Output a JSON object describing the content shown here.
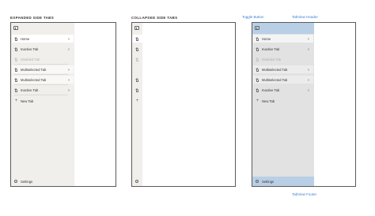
{
  "sections": {
    "expanded_title": "EXPANDED SIDE TABS",
    "collapsed_title": "COLLAPSED SIDE TABS"
  },
  "annotations": {
    "toggle_button": "Toggle Button",
    "tabview_header": "TabView Header",
    "tabview_footer": "TabView Footer"
  },
  "tabs": [
    {
      "label": "Home",
      "state": "selected",
      "close": "×"
    },
    {
      "label": "Inactive Tab",
      "state": "normal",
      "close": "×"
    },
    {
      "label": "Disabled Tab",
      "state": "disabled",
      "close": ""
    },
    {
      "label": "Multiselected Tab",
      "state": "multiselected",
      "close": "×"
    },
    {
      "label": "Multiselected Tab",
      "state": "multiselected",
      "close": "×"
    },
    {
      "label": "Inactive Tab",
      "state": "normal",
      "close": "×"
    }
  ],
  "new_tab": {
    "label": "New Tab",
    "icon": "+"
  },
  "settings": {
    "label": "Settings"
  },
  "colors": {
    "sidebar": "#f1efeb",
    "overlay_sidebar": "#e2e2e2",
    "highlight_band": "#b9cfe6",
    "annotation": "#3a7fd5"
  }
}
